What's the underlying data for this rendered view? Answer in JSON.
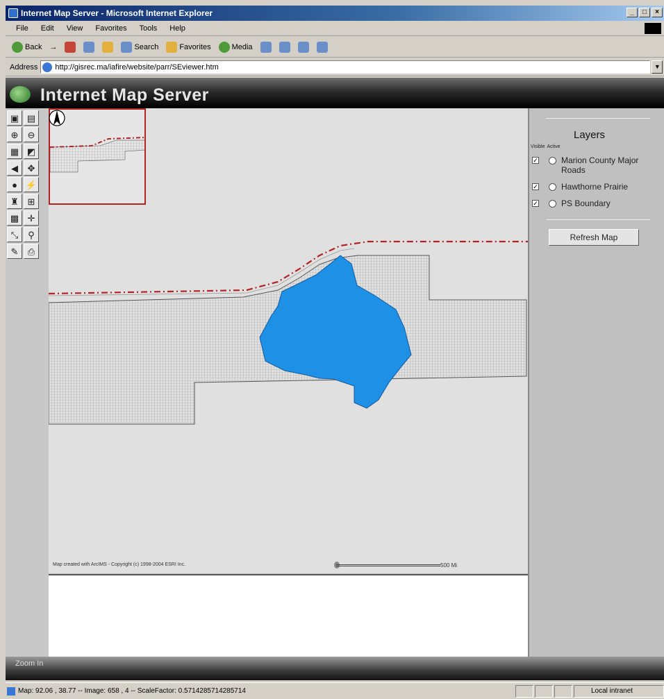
{
  "window": {
    "title": "Internet Map Server - Microsoft Internet Explorer",
    "controls": [
      "_",
      "□",
      "×"
    ]
  },
  "menubar": {
    "items": [
      "File",
      "Edit",
      "View",
      "Favorites",
      "Tools",
      "Help"
    ]
  },
  "toolbar": {
    "back": "Back",
    "forward": "→",
    "search": "Search",
    "favorites": "Favorites",
    "media": "Media"
  },
  "addressbar": {
    "label": "Address",
    "url": "http://gisrec.ma/iafire/website/parr/SEviewer.htm"
  },
  "page": {
    "banner_title": "Internet Map Server",
    "zoom_label": "Zoom In",
    "map": {
      "copyright": "Map created with ArcIMS - Copyright (c) 1998-2004 ESRI Inc.",
      "scale_label": "500 Mi"
    },
    "layers": {
      "heading": "Layers",
      "col_visible": "Visible",
      "col_active": "Active",
      "items": [
        {
          "name": "Marion County Major Roads",
          "visible": true
        },
        {
          "name": "Hawthorne Prairie",
          "visible": true
        },
        {
          "name": "PS Boundary",
          "visible": true
        }
      ],
      "refresh_label": "Refresh Map"
    }
  },
  "statusbar": {
    "text": "Map: 92.06 , 38.77 -- Image: 658 , 4 -- ScaleFactor: 0.5714285714285714",
    "zone": "Local intranet"
  }
}
